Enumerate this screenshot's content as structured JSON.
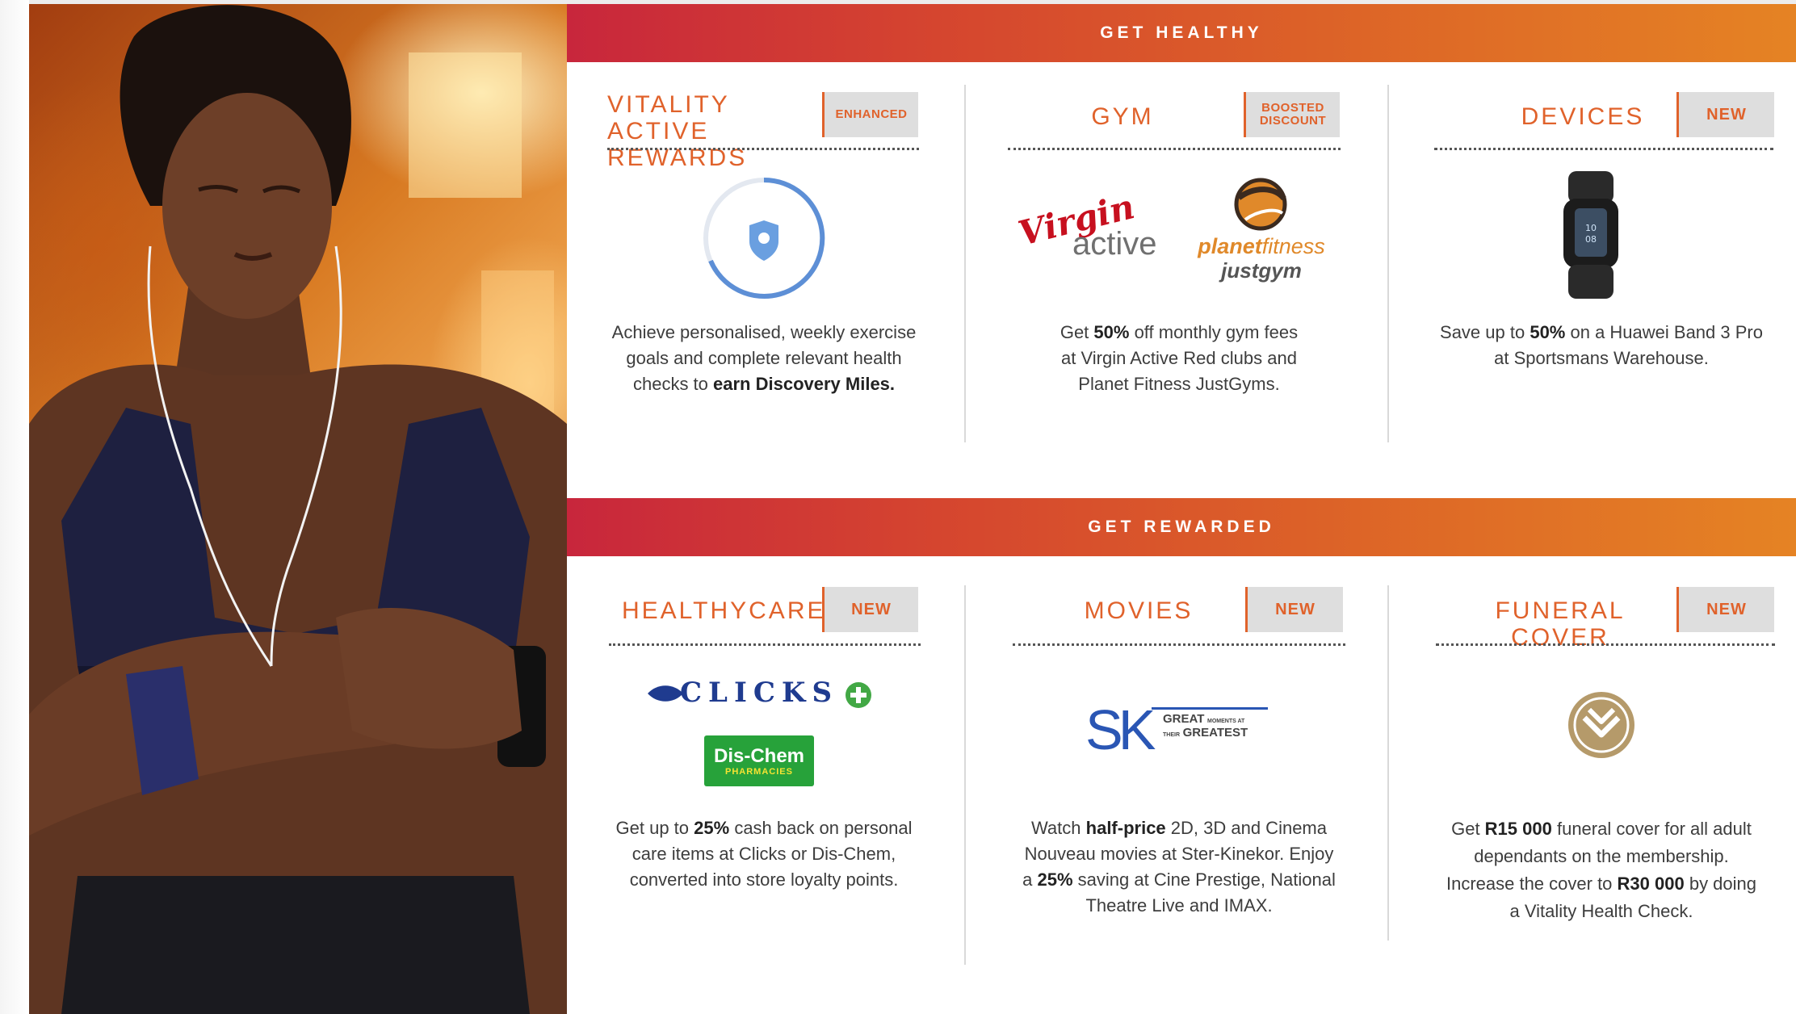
{
  "sections": {
    "healthy": "GET HEALTHY",
    "rewarded": "GET REWARDED"
  },
  "cards": {
    "vitality": {
      "title_line1": "VITALITY ACTIVE",
      "title_line2": "REWARDS",
      "tag": "ENHANCED",
      "desc": [
        "Achieve personalised, weekly exercise",
        "goals and complete relevant health",
        "checks to ",
        "earn Discovery Miles."
      ],
      "icon": "vitality-ring-shield-icon"
    },
    "gym": {
      "title": "GYM",
      "tag_line1": "BOOSTED",
      "tag_line2": "DISCOUNT",
      "logos": {
        "virgin_script": "Virgin",
        "virgin_word": "active",
        "planet": "planet",
        "fitness": "fitness",
        "justgym": "justgym"
      },
      "desc": [
        "Get ",
        "50%",
        " off monthly gym fees",
        "at Virgin Active Red clubs and",
        "Planet Fitness JustGyms."
      ]
    },
    "devices": {
      "title": "DEVICES",
      "tag": "NEW",
      "desc": [
        "Save up to ",
        "50%",
        " on a Huawei Band 3 Pro",
        "at Sportsmans Warehouse."
      ],
      "icon": "fitness-band-icon"
    },
    "healthycare": {
      "title": "HEALTHYCARE",
      "tag": "NEW",
      "logos": {
        "clicks": "CLICKS",
        "dischem": "Dis-Chem",
        "dischem_sub": "PHARMACIES"
      },
      "desc": [
        "Get up to ",
        "25%",
        " cash back on personal",
        "care items at Clicks or Dis-Chem,",
        "converted into store loyalty points."
      ]
    },
    "movies": {
      "title": "MOVIES",
      "tag": "NEW",
      "logos": {
        "sk": "SK",
        "great1": "GREAT",
        "great_small1": "MOMENTS AT",
        "great_small2": "THEIR",
        "great2": "GREATEST"
      },
      "desc": [
        "Watch ",
        "half-price",
        " 2D, 3D and Cinema",
        "Nouveau movies at Ster-Kinekor. Enjoy",
        "a ",
        "25%",
        " saving at Cine Prestige, National",
        "Theatre Live and IMAX."
      ]
    },
    "funeral": {
      "title": "FUNERAL COVER",
      "tag": "NEW",
      "desc": [
        "Get ",
        "R15 000",
        " funeral cover for all adult",
        "dependants on the membership.",
        "Increase the cover to ",
        "R30 000",
        " by doing",
        "a Vitality Health Check."
      ],
      "icon": "discovery-logo-icon"
    }
  },
  "colors": {
    "accent": "#e0622b",
    "band_start": "#c8263c",
    "band_end": "#e58324",
    "tag_bg": "#dedede"
  }
}
